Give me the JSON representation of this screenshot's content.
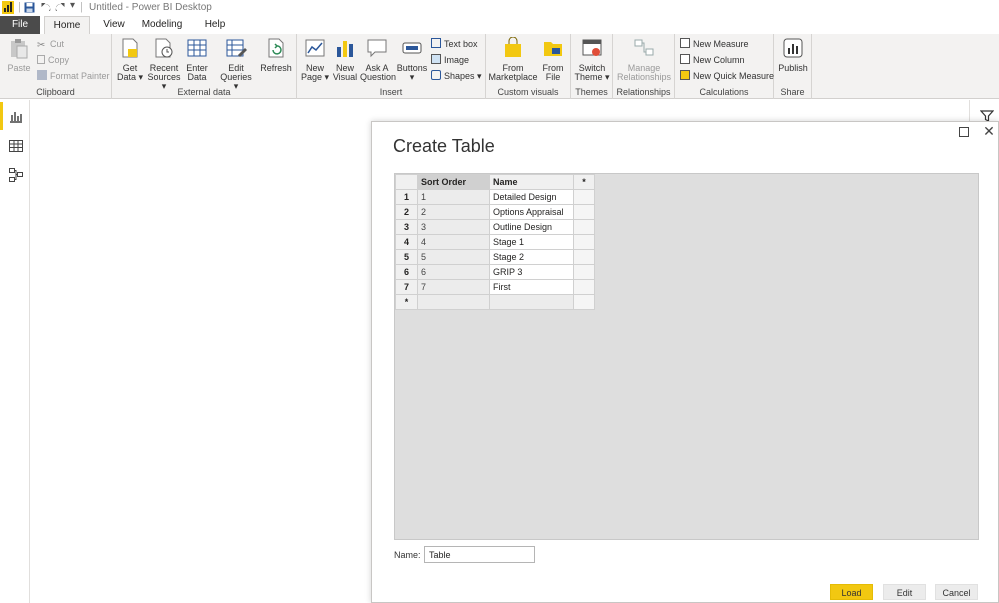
{
  "app": {
    "title": "Untitled - Power BI Desktop",
    "accent": "#f2c811"
  },
  "quick_access": {
    "save_icon": "save-icon",
    "undo_icon": "undo-icon",
    "redo_icon": "redo-icon",
    "customize": "▾"
  },
  "tabs": [
    {
      "label": "File"
    },
    {
      "label": "Home"
    },
    {
      "label": "View"
    },
    {
      "label": "Modeling"
    },
    {
      "label": "Help"
    }
  ],
  "ribbon": {
    "clipboard": {
      "label": "Clipboard",
      "paste": "Paste",
      "cut": "Cut",
      "copy": "Copy",
      "format_painter": "Format Painter"
    },
    "external_data": {
      "label": "External data",
      "get_data_1": "Get",
      "get_data_2": "Data ▾",
      "recent_1": "Recent",
      "recent_2": "Sources ▾",
      "enter_1": "Enter",
      "enter_2": "Data",
      "edit_1": "Edit",
      "edit_2": "Queries ▾",
      "refresh": "Refresh"
    },
    "insert": {
      "label": "Insert",
      "new_page_1": "New",
      "new_page_2": "Page ▾",
      "new_visual_1": "New",
      "new_visual_2": "Visual",
      "ask_1": "Ask A",
      "ask_2": "Question",
      "buttons": "Buttons ▾",
      "text_box": "Text box",
      "image": "Image",
      "shapes": "Shapes ▾"
    },
    "custom_visuals": {
      "label": "Custom visuals",
      "marketplace_1": "From",
      "marketplace_2": "Marketplace",
      "file_1": "From",
      "file_2": "File"
    },
    "themes": {
      "label": "Themes",
      "switch_1": "Switch",
      "switch_2": "Theme ▾"
    },
    "relationships": {
      "label": "Relationships",
      "manage_1": "Manage",
      "manage_2": "Relationships"
    },
    "calculations": {
      "label": "Calculations",
      "new_measure": "New Measure",
      "new_column": "New Column",
      "new_quick_measure": "New Quick Measure"
    },
    "share": {
      "label": "Share",
      "publish": "Publish"
    }
  },
  "dialog": {
    "title": "Create Table",
    "columns": [
      "Sort Order",
      "Name",
      "*"
    ],
    "rows": [
      {
        "num": "1",
        "sort": "1",
        "name": "Detailed Design"
      },
      {
        "num": "2",
        "sort": "2",
        "name": "Options Appraisal"
      },
      {
        "num": "3",
        "sort": "3",
        "name": "Outline Design"
      },
      {
        "num": "4",
        "sort": "4",
        "name": "Stage 1"
      },
      {
        "num": "5",
        "sort": "5",
        "name": "Stage 2"
      },
      {
        "num": "6",
        "sort": "6",
        "name": "GRIP 3"
      },
      {
        "num": "7",
        "sort": "7",
        "name": "First"
      }
    ],
    "new_row_marker": "*",
    "name_label": "Name:",
    "name_value": "Table",
    "buttons": {
      "load": "Load",
      "edit": "Edit",
      "cancel": "Cancel"
    },
    "close_glyph": "✕"
  }
}
